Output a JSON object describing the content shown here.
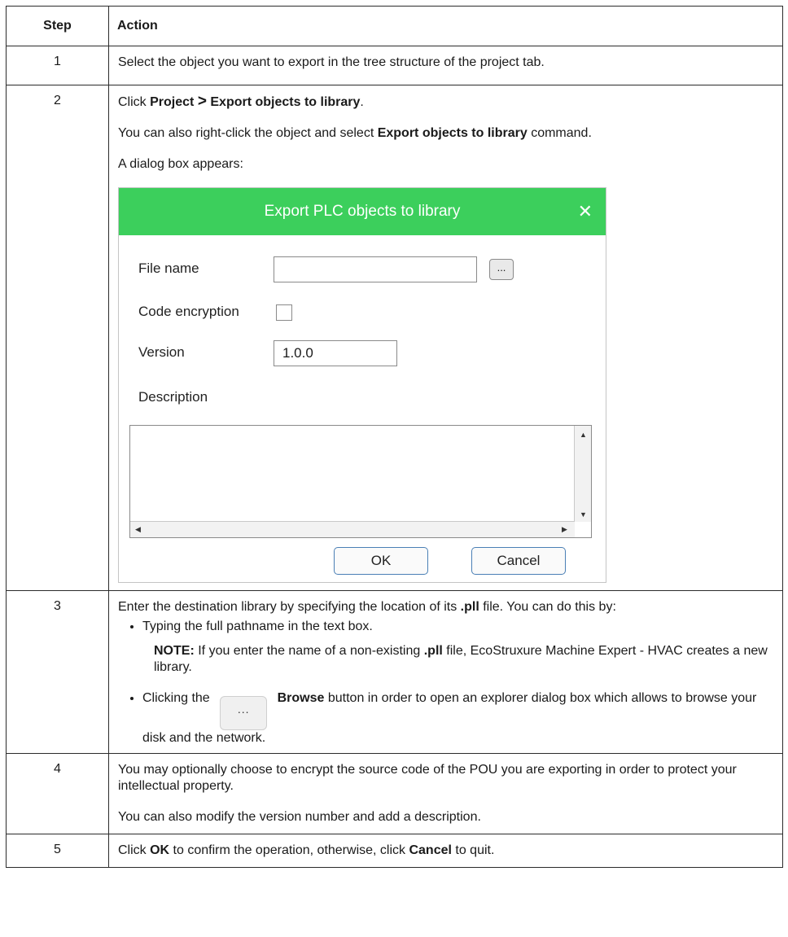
{
  "headers": {
    "step": "Step",
    "action": "Action"
  },
  "rows": [
    {
      "step": "1",
      "text": "Select the object you want to export in the tree structure of the project tab."
    },
    {
      "step": "2",
      "line1_pre": "Click ",
      "line1_b1": "Project",
      "line1_gt": ">",
      "line1_b2": "Export objects to library",
      "line1_post": ".",
      "line2_pre": "You can also right-click the object and select ",
      "line2_b": "Export objects to library",
      "line2_post": " command.",
      "line3": "A dialog box appears:"
    },
    {
      "step": "3",
      "intro_pre": "Enter the destination library by specifying the location of its ",
      "intro_b": ".pll",
      "intro_post": " file. You can do this by:",
      "bullet1": "Typing the full pathname in the text box.",
      "note_b": "NOTE:",
      "note_pre": " If you enter the name of a non-existing ",
      "note_b2": ".pll",
      "note_post": " file, EcoStruxure Machine Expert - HVAC creates a new library.",
      "bullet2_pre": "Clicking the",
      "bullet2_b": "Browse",
      "bullet2_post": " button in order to open an explorer dialog box which allows to browse your disk and the network."
    },
    {
      "step": "4",
      "p1": "You may optionally choose to encrypt the source code of the POU you are exporting in order to protect your intellectual property.",
      "p2": "You can also modify the version number and add a description."
    },
    {
      "step": "5",
      "pre": "Click ",
      "b1": "OK",
      "mid": " to confirm the operation, otherwise, click ",
      "b2": "Cancel",
      "post": " to quit."
    }
  ],
  "dialog": {
    "title": "Export PLC objects to library",
    "close_glyph": "✕",
    "file_name_label": "File name",
    "file_name_value": "",
    "browse_label": "...",
    "code_encryption_label": "Code encryption",
    "code_encryption_checked": false,
    "version_label": "Version",
    "version_value": "1.0.0",
    "description_label": "Description",
    "ok_label": "OK",
    "cancel_label": "Cancel",
    "title_color": "#3ccf5c"
  }
}
